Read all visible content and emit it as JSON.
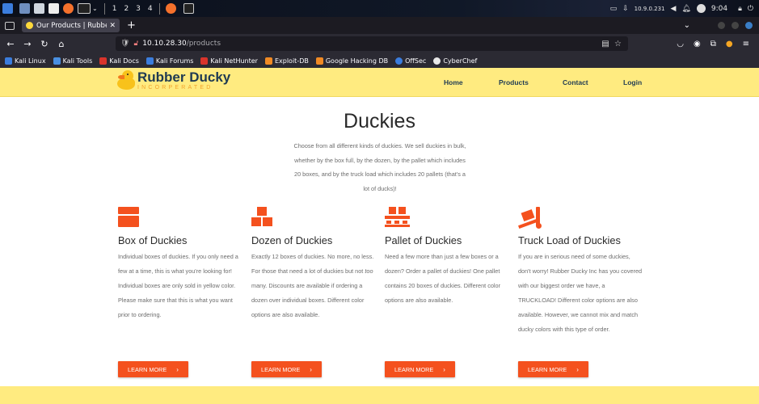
{
  "taskbar": {
    "workspaces": [
      "1",
      "2",
      "3",
      "4"
    ],
    "ip": "10.9.0.231",
    "time": "9:04"
  },
  "browser": {
    "tab_title": "Our Products | Rubber Du",
    "url_host": "10.10.28.30",
    "url_path": "/products",
    "bookmarks": [
      "Kali Linux",
      "Kali Tools",
      "Kali Docs",
      "Kali Forums",
      "Kali NetHunter",
      "Exploit-DB",
      "Google Hacking DB",
      "OffSec",
      "CyberChef"
    ]
  },
  "site": {
    "logo_name": "Rubber Ducky",
    "logo_sub": "INCORPERATED",
    "nav": [
      "Home",
      "Products",
      "Contact",
      "Login"
    ],
    "title": "Duckies",
    "intro": "Choose from all different kinds of duckies. We sell duckies in bulk, whether by the box full, by the dozen, by the pallet which includes 20 boxes, and by the truck load which includes 20 pallets (that's a lot of ducks)!",
    "products": [
      {
        "title": "Box of Duckies",
        "desc": "Individual boxes of duckies. If you only need a few at a time, this is what you're looking for! Individual boxes are only sold in yellow color. Please make sure that this is what you want prior to ordering.",
        "icon": "box-icon"
      },
      {
        "title": "Dozen of Duckies",
        "desc_before": "Exactly 12 boxes of duckies. No more, no less. For those that need a lot of duckies but not ",
        "desc_em": "too",
        "desc_after": " many. Discounts are available if ordering a dozen over individual boxes. Different color options are also available.",
        "icon": "boxes-icon"
      },
      {
        "title": "Pallet of Duckies",
        "desc": "Need a few more than just a few boxes or a dozen? Order a pallet of duckies! One pallet contains 20 boxes of duckies. Different color options are also available.",
        "icon": "pallet-icon"
      },
      {
        "title": "Truck Load of Duckies",
        "desc": "If you are in serious need of some duckies, don't worry! Rubber Ducky Inc has you covered with our biggest order we have, a TRUCKLOAD! Different color options are also available. However, we cannot mix and match ducky colors with this type of order.",
        "icon": "dolly-icon"
      }
    ],
    "button_label": "LEARN MORE",
    "button_arrow": "›"
  },
  "colors": {
    "accent": "#f4511e",
    "header_bg": "#ffeb80",
    "heading": "#1e3a52"
  }
}
